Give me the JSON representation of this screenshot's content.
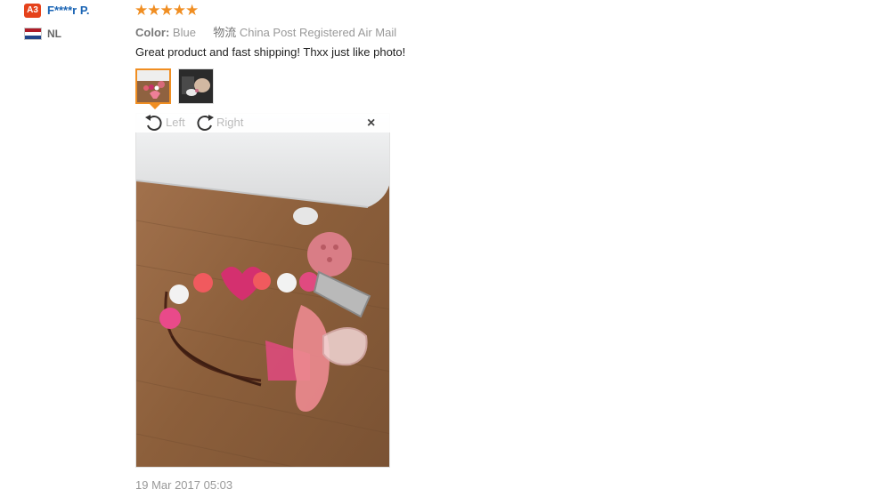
{
  "user": {
    "level_badge": "A3",
    "name": "F****r P.",
    "country_code": "NL"
  },
  "review": {
    "stars": "★★★★★",
    "rating": 5,
    "color_label": "Color:",
    "color_value": "Blue",
    "shipping_label": "物流",
    "shipping_value": "China Post Registered Air Mail",
    "text": "Great product and fast shipping! Thxx just like photo!",
    "date": "19 Mar 2017 05:03"
  },
  "viewer": {
    "rotate_left": "Left",
    "rotate_right": "Right",
    "close": "×"
  },
  "colors": {
    "accent": "#f08e22",
    "badge": "#e5421b",
    "link": "#1a64b4"
  }
}
